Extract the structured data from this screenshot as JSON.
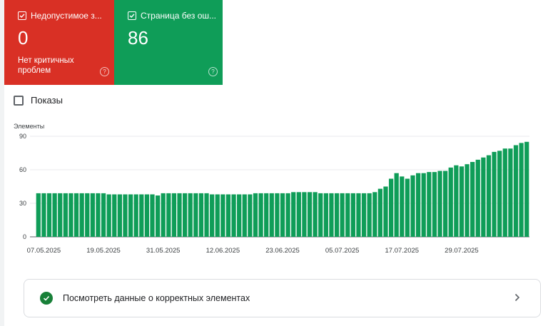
{
  "cards": [
    {
      "title": "Недопустимое з...",
      "value": "0",
      "subtitle": "Нет критичных проблем",
      "color": "#d93025"
    },
    {
      "title": "Страница без ош...",
      "value": "86",
      "subtitle": "",
      "color": "#0f9d58"
    }
  ],
  "impressions_label": "Показы",
  "valid_link_label": "Посмотреть данные о корректных элементах",
  "icons": {
    "checkbox": "checkbox-checked-icon",
    "help": "help-icon",
    "check": "check-circle-icon",
    "chevron": "chevron-right-icon"
  },
  "chart_data": {
    "type": "bar",
    "ylabel": "Элементы",
    "ylim": [
      0,
      90
    ],
    "yticks": [
      "90",
      "60",
      "30",
      "0"
    ],
    "tick_labels": [
      "07.05.2025",
      "19.05.2025",
      "31.05.2025",
      "12.06.2025",
      "23.06.2025",
      "05.07.2025",
      "17.07.2025",
      "29.07.2025"
    ],
    "color": "#0f9d58",
    "values": [
      39,
      39,
      39,
      39,
      39,
      39,
      39,
      39,
      39,
      39,
      39,
      39,
      39,
      38,
      38,
      38,
      38,
      38,
      38,
      38,
      38,
      38,
      37,
      39,
      39,
      39,
      39,
      39,
      39,
      39,
      39,
      39,
      38,
      38,
      38,
      38,
      38,
      38,
      38,
      38,
      39,
      39,
      39,
      39,
      39,
      39,
      39,
      40,
      40,
      40,
      40,
      40,
      39,
      39,
      39,
      39,
      39,
      39,
      39,
      39,
      39,
      39,
      40,
      43,
      45,
      52,
      57,
      54,
      52,
      55,
      57,
      57,
      58,
      58,
      59,
      59,
      62,
      64,
      63,
      65,
      67,
      69,
      71,
      73,
      76,
      77,
      79,
      79,
      82,
      84,
      85
    ]
  }
}
